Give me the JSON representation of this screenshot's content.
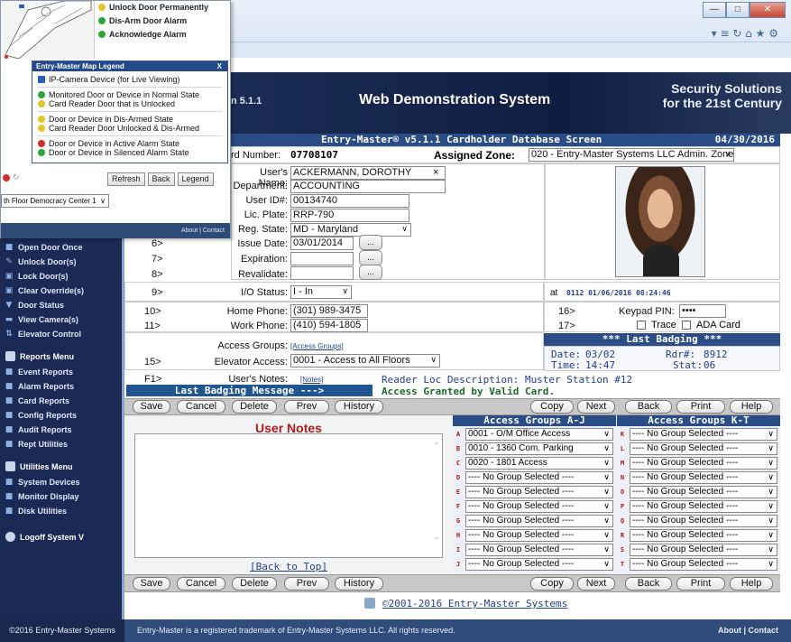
{
  "browser": {
    "icons": [
      "close-icon",
      "minimize-icon",
      "maximize-icon",
      "home-icon",
      "star-icon",
      "gear-icon"
    ],
    "addr_icons": "▾ ≡ ↻   ⌂ ★ ⚙"
  },
  "popup": {
    "actions": [
      "Unlock Door Permanently",
      "Dis-Arm Door Alarm",
      "Acknowledge Alarm"
    ],
    "legend_title": "Entry-Master Map Legend",
    "legend_close": "X",
    "legend_items": [
      {
        "text": "IP-Camera Device (for Live Viewing)",
        "color": "#2a5fb4"
      },
      {
        "text": "Monitored Door or Device in Normal State",
        "color": "#2ca53a"
      },
      {
        "text": "Card Reader Door that is Unlocked",
        "color": "#e3c62a"
      },
      {
        "text": "Door or Device in Dis-Armed State",
        "color": "#e3c62a"
      },
      {
        "text": "Card Reader Door Unlocked & Dis-Armed",
        "color": "#e3c62a"
      },
      {
        "text": "Door or Device in Active Alarm State",
        "color": "#d62b2b"
      },
      {
        "text": "Door or Device in Silenced Alarm State",
        "color": "#2ca53a"
      }
    ],
    "buttons": [
      "Refresh",
      "Back",
      "Legend"
    ],
    "location": "th Floor Democracy Center 1",
    "footer": "About | Contact"
  },
  "banner": {
    "version": "n 5.1.1",
    "title": "Web Demonstration System",
    "slogan_line1": "Security Solutions",
    "slogan_line2": "for the 21st Century"
  },
  "nav": {
    "top_items": [
      {
        "label": "Open Door Once",
        "icon": "door-icon"
      },
      {
        "label": "Unlock Door(s)",
        "icon": "unlock-icon"
      },
      {
        "label": "Lock Door(s)",
        "icon": "lock-icon"
      },
      {
        "label": "Clear Override(s)",
        "icon": "clear-icon"
      },
      {
        "label": "Door Status",
        "icon": "status-icon"
      },
      {
        "label": "View Camera(s)",
        "icon": "camera-icon"
      },
      {
        "label": "Elevator Control",
        "icon": "elevator-icon"
      }
    ],
    "reports_header": "Reports Menu",
    "reports_items": [
      "Event Reports",
      "Alarm Reports",
      "Card Reports",
      "Config Reports",
      "Audit Reports",
      "Rept Utilities"
    ],
    "utilities_header": "Utilities Menu",
    "utilities_items": [
      "System Devices",
      "Monitor Display",
      "Disk Utilities"
    ],
    "logoff": "Logoff System V",
    "footer": "©2016 Entry-Master Systems"
  },
  "form": {
    "header_title": "Entry-Master® v5.1.1 Cardholder Database Screen",
    "header_date": "04/30/2016",
    "card_number_label": "rd Number:",
    "card_number": "07708107",
    "assigned_zone_label": "Assigned Zone:",
    "assigned_zone": "020 - Entry-Master Systems LLC Admin. Zone",
    "users_name_label": "User's Name:",
    "users_name": "ACKERMANN, DOROTHY",
    "department_label": "Department:",
    "department": "ACCOUNTING",
    "user_id_label": "User ID#:",
    "user_id": "00134740",
    "lic_plate_label": "Lic. Plate:",
    "lic_plate": "RRP-790",
    "reg_state_label": "Reg. State:",
    "reg_state": "MD - Maryland",
    "issue_date_label": "Issue Date:",
    "issue_date": "03/01/2014",
    "expiration_label": "Expiration:",
    "revalidate_label": "Revalidate:",
    "row_nums": [
      "6>",
      "7>",
      "8>",
      "9>",
      "10>",
      "11>",
      "15>",
      "16>",
      "17>",
      "F1>"
    ],
    "dots": "...",
    "io_status_label": "I/O Status:",
    "io_status": "I - In",
    "at_label": "at",
    "io_time": "0112  01/06/2016 08:24:46",
    "home_phone_label": "Home Phone:",
    "home_phone": "(301) 989-3475",
    "work_phone_label": "Work Phone:",
    "work_phone": "(410) 594-1805",
    "keypad_label": "Keypad PIN:",
    "keypad_pin": "••••",
    "trace_label": "Trace",
    "ada_label": "ADA Card",
    "access_groups_label": "Access Groups:",
    "access_groups_link": "[Access Groups]",
    "elevator_access_label": "Elevator Access:",
    "elevator_access": "0001 - Access to All Floors",
    "last_badging_title": "*** Last Badging ***",
    "date_label": "Date:",
    "date_val": "03/02",
    "time_label": "Time:",
    "time_val": "14:47",
    "rdr_label": "Rdr#:",
    "rdr_val": "8912",
    "stat_label": "Stat:",
    "stat_val": "06",
    "user_notes_label": "User's Notes:",
    "notes_link": "[Notes]",
    "last_msg_label": "Last Badging Message --->",
    "reader_loc": "Reader Loc Description: Muster Station #12",
    "access_granted": "Access Granted by Valid Card.",
    "user_notes_title": "User Notes",
    "back_to_top": "[Back to Top]"
  },
  "buttons": [
    "Save",
    "Cancel",
    "Delete",
    "Prev",
    "History",
    "Copy",
    "Next",
    "Back",
    "Print",
    "Help"
  ],
  "access_groups": {
    "title_left": "Access Groups A-J",
    "title_right": "Access Groups K-T",
    "left": [
      {
        "letter": "A",
        "value": "0001 - O/M Office Access"
      },
      {
        "letter": "B",
        "value": "0010 - 1360 Com. Parking"
      },
      {
        "letter": "C",
        "value": "0020 - 1801 Access"
      },
      {
        "letter": "D",
        "value": "---- No Group Selected ----"
      },
      {
        "letter": "E",
        "value": "---- No Group Selected ----"
      },
      {
        "letter": "F",
        "value": "---- No Group Selected ----"
      },
      {
        "letter": "G",
        "value": "---- No Group Selected ----"
      },
      {
        "letter": "H",
        "value": "---- No Group Selected ----"
      },
      {
        "letter": "I",
        "value": "---- No Group Selected ----"
      },
      {
        "letter": "J",
        "value": "---- No Group Selected ----"
      }
    ],
    "right": [
      {
        "letter": "K",
        "value": "---- No Group Selected ----"
      },
      {
        "letter": "L",
        "value": "---- No Group Selected ----"
      },
      {
        "letter": "M",
        "value": "---- No Group Selected ----"
      },
      {
        "letter": "N",
        "value": "---- No Group Selected ----"
      },
      {
        "letter": "O",
        "value": "---- No Group Selected ----"
      },
      {
        "letter": "P",
        "value": "---- No Group Selected ----"
      },
      {
        "letter": "Q",
        "value": "---- No Group Selected ----"
      },
      {
        "letter": "R",
        "value": "---- No Group Selected ----"
      },
      {
        "letter": "S",
        "value": "---- No Group Selected ----"
      },
      {
        "letter": "T",
        "value": "---- No Group Selected ----"
      }
    ]
  },
  "copyright": "©2001-2016 Entry-Master Systems",
  "footer": {
    "text": "Entry-Master is a registered trademark of Entry-Master Systems LLC.  All rights reserved.",
    "right": "About | Contact"
  }
}
